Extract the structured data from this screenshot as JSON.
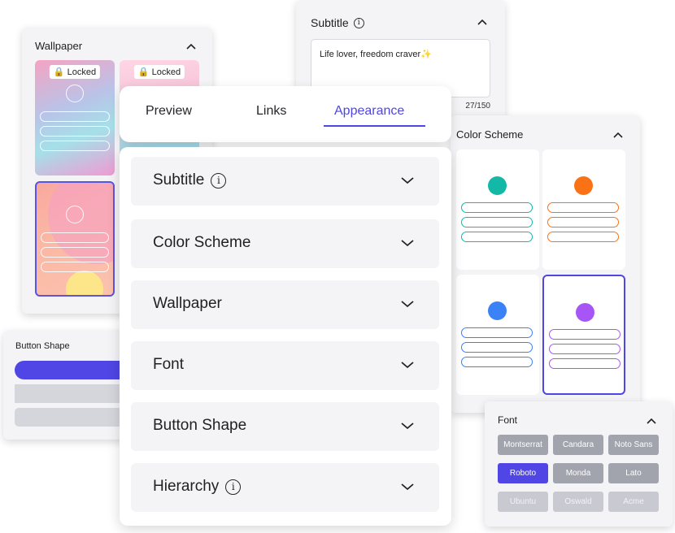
{
  "wallpaper": {
    "title": "Wallpaper",
    "locked_label": "Locked"
  },
  "subtitle_card": {
    "title": "Subtitle",
    "text": "Life lover, freedom craver✨",
    "counter": "27/150"
  },
  "button_shape": {
    "title": "Button Shape"
  },
  "color_scheme": {
    "title": "Color Scheme",
    "colors": [
      "#14b8a6",
      "#f97316",
      "#3b82f6",
      "#a855f7"
    ],
    "selected": 3
  },
  "font": {
    "title": "Font",
    "options": [
      "Montserrat",
      "Candara",
      "Noto Sans",
      "Roboto",
      "Monda",
      "Lato",
      "Ubuntu",
      "Oswald",
      "Acme"
    ],
    "selected": "Roboto"
  },
  "tabs": {
    "preview": "Preview",
    "links": "Links",
    "appearance": "Appearance",
    "active": "Appearance"
  },
  "accordion": [
    {
      "label": "Subtitle"
    },
    {
      "label": "Color Scheme"
    },
    {
      "label": "Wallpaper"
    },
    {
      "label": "Font"
    },
    {
      "label": "Button Shape"
    },
    {
      "label": "Hierarchy"
    }
  ],
  "colors": {
    "accent": "#4f46e5",
    "panel_bg": "#f4f4f6"
  }
}
